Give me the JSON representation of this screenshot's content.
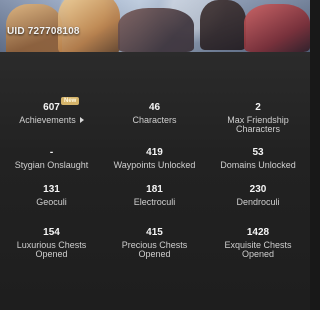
{
  "header": {
    "uid": "UID 727708108"
  },
  "stats": [
    [
      {
        "value": "607",
        "label": "Achievements",
        "badge": "New"
      },
      {
        "value": "46",
        "label": "Characters"
      },
      {
        "value": "2",
        "label": "Max Friendship Characters"
      }
    ],
    [
      {
        "value": "-",
        "label": "Stygian Onslaught"
      },
      {
        "value": "419",
        "label": "Waypoints Unlocked"
      },
      {
        "value": "53",
        "label": "Domains Unlocked"
      }
    ],
    [
      {
        "value": "131",
        "label": "Geoculi"
      },
      {
        "value": "181",
        "label": "Electroculi"
      },
      {
        "value": "230",
        "label": "Dendroculi"
      }
    ],
    [
      {
        "value": "154",
        "label": "Luxurious Chests Opened"
      },
      {
        "value": "415",
        "label": "Precious Chests Opened"
      },
      {
        "value": "1428",
        "label": "Exquisite Chests Opened"
      }
    ]
  ],
  "icons": {
    "achievement_chevron": "chevron-right-icon"
  }
}
